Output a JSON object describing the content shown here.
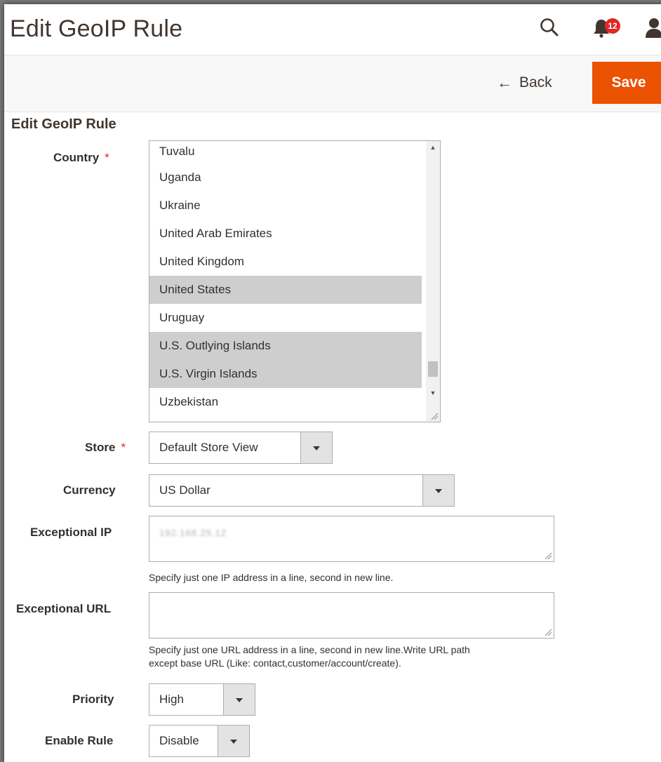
{
  "header": {
    "title": "Edit GeoIP Rule",
    "notifications_count": "12"
  },
  "actions": {
    "back_label": "Back",
    "save_label": "Save",
    "save_color": "#eb5202"
  },
  "form": {
    "section_title": "Edit GeoIP Rule",
    "country": {
      "label": "Country",
      "options": [
        {
          "label": "Tuvalu",
          "selected": false
        },
        {
          "label": "Uganda",
          "selected": false
        },
        {
          "label": "Ukraine",
          "selected": false
        },
        {
          "label": "United Arab Emirates",
          "selected": false
        },
        {
          "label": "United Kingdom",
          "selected": false
        },
        {
          "label": "United States",
          "selected": true
        },
        {
          "label": "Uruguay",
          "selected": false
        },
        {
          "label": "U.S. Outlying Islands",
          "selected": true
        },
        {
          "label": "U.S. Virgin Islands",
          "selected": true
        },
        {
          "label": "Uzbekistan",
          "selected": false
        }
      ]
    },
    "store": {
      "label": "Store",
      "value": "Default Store View"
    },
    "currency": {
      "label": "Currency",
      "value": "US Dollar"
    },
    "exceptional_ip": {
      "label": "Exceptional IP",
      "value": "192.168.25.12",
      "note": "Specify just one IP address in a line, second in new line."
    },
    "exceptional_url": {
      "label": "Exceptional URL",
      "value": "",
      "note_line1": "Specify just one URL address in a line, second in new line.Write URL path",
      "note_line2": "except base URL (Like: contact,customer/account/create)."
    },
    "priority": {
      "label": "Priority",
      "value": "High"
    },
    "enable_rule": {
      "label": "Enable Rule",
      "value": "Disable"
    }
  }
}
